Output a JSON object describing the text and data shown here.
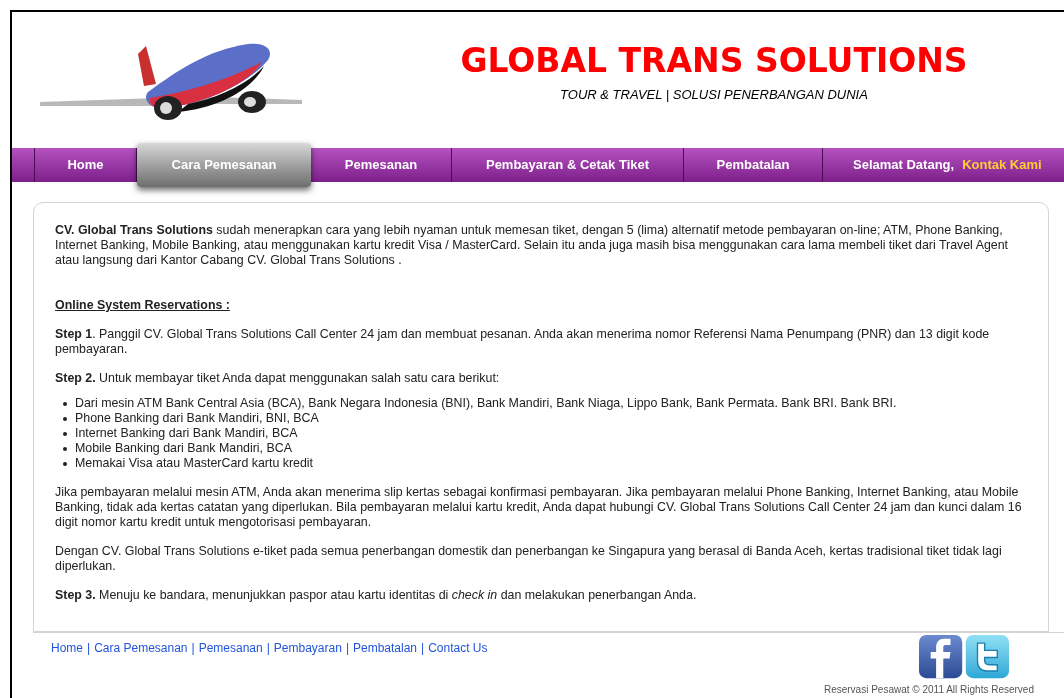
{
  "header": {
    "title": "GLOBAL TRANS SOLUTIONS",
    "tagline": "TOUR & TRAVEL | SOLUSI PENERBANGAN DUNIA"
  },
  "nav": {
    "items": [
      {
        "label": "Home",
        "selected": false
      },
      {
        "label": "Cara Pemesanan",
        "selected": true
      },
      {
        "label": "Pemesanan",
        "selected": false
      },
      {
        "label": "Pembayaran & Cetak Tiket",
        "selected": false
      },
      {
        "label": "Pembatalan",
        "selected": false
      }
    ],
    "welcome": "Selamat Datang,",
    "contact": "Kontak Kami"
  },
  "content": {
    "intro": "**CV. Global Trans Solutions** sudah menerapkan cara yang lebih nyaman untuk memesan tiket, dengan 5 (lima) alternatif metode pembayaran on-line; ATM, Phone Banking, Internet Banking, Mobile Banking, atau menggunakan kartu kredit Visa / MasterCard. Selain itu anda juga masih bisa menggunakan cara lama membeli tiket dari Travel Agent atau langsung dari Kantor Cabang CV. Global Trans Solutions .",
    "heading": "Online System Reservations :",
    "blocks": [
      {
        "kind": "para",
        "text": "**Step 1**. Panggil CV. Global Trans Solutions Call Center 24 jam dan membuat pesanan. Anda akan menerima nomor Referensi Nama Penumpang (PNR) dan 13 digit kode pembayaran."
      },
      {
        "kind": "para",
        "text": "**Step 2.** Untuk membayar tiket Anda dapat menggunakan salah satu cara berikut:"
      },
      {
        "kind": "list",
        "items": [
          "Dari mesin ATM Bank Central Asia (BCA), Bank Negara Indonesia (BNI), Bank Mandiri, Bank Niaga, Lippo Bank, Bank Permata. Bank BRI. Bank BRI.",
          "Phone Banking dari Bank Mandiri, BNI, BCA",
          "Internet Banking dari Bank Mandiri, BCA",
          "Mobile Banking dari Bank Mandiri, BCA",
          "Memakai Visa atau MasterCard kartu kredit"
        ]
      },
      {
        "kind": "para",
        "text": "Jika pembayaran melalui mesin ATM, Anda akan menerima slip kertas sebagai konfirmasi pembayaran. Jika pembayaran melalui Phone Banking, Internet Banking, atau Mobile Banking, tidak ada kertas catatan yang diperlukan. Bila pembayaran melalui kartu kredit, Anda dapat hubungi CV. Global Trans Solutions Call Center 24 jam dan kunci dalam 16 digit nomor kartu kredit untuk mengotorisasi pembayaran."
      },
      {
        "kind": "para",
        "text": "Dengan CV. Global Trans Solutions e-tiket pada semua penerbangan domestik dan penerbangan ke Singapura yang berasal di Banda Aceh, kertas tradisional tiket tidak lagi diperlukan."
      },
      {
        "kind": "para",
        "text": "**Step 3.** Menuju ke bandara, menunjukkan paspor atau kartu identitas di *check in* dan melakukan penerbangan Anda."
      }
    ]
  },
  "footer": {
    "links": [
      "Home",
      "Cara Pemesanan",
      "Pemesanan",
      "Pembayaran",
      "Pembatalan",
      "Contact Us"
    ],
    "separator": "|",
    "copyright": "Reservasi Pesawat © 2011 All Rights Reserved"
  }
}
